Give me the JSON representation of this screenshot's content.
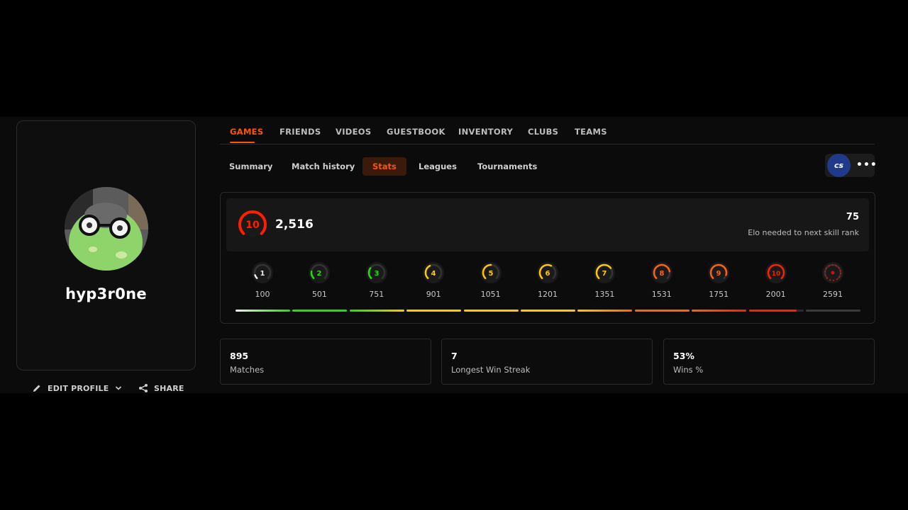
{
  "profile": {
    "username": "hyp3r0ne",
    "edit_label": "EDIT PROFILE",
    "share_label": "SHARE"
  },
  "main_tabs": [
    {
      "label": "GAMES",
      "active": true
    },
    {
      "label": "FRIENDS"
    },
    {
      "label": "VIDEOS"
    },
    {
      "label": "GUESTBOOK"
    },
    {
      "label": "INVENTORY"
    },
    {
      "label": "CLUBS"
    },
    {
      "label": "TEAMS"
    }
  ],
  "sub_tabs": [
    {
      "label": "Summary"
    },
    {
      "label": "Match history"
    },
    {
      "label": "Stats",
      "active": true
    },
    {
      "label": "Leagues"
    },
    {
      "label": "Tournaments"
    }
  ],
  "game_switch": {
    "logo_text": "cs",
    "more_icon": "more-dots-icon"
  },
  "elo": {
    "current_level": "10",
    "value": "2,516",
    "needed": "75",
    "needed_label": "Elo needed to next skill rank"
  },
  "levels": [
    {
      "level": "1",
      "elo": "100",
      "color": "#eeeeee",
      "progress": 0.1
    },
    {
      "level": "2",
      "elo": "501",
      "color": "#1ce400",
      "progress": 0.2
    },
    {
      "level": "3",
      "elo": "751",
      "color": "#1ce400",
      "progress": 0.3
    },
    {
      "level": "4",
      "elo": "901",
      "color": "#ffc800",
      "progress": 0.4
    },
    {
      "level": "5",
      "elo": "1051",
      "color": "#ffc800",
      "progress": 0.5
    },
    {
      "level": "6",
      "elo": "1201",
      "color": "#ffc800",
      "progress": 0.6
    },
    {
      "level": "7",
      "elo": "1351",
      "color": "#ffc800",
      "progress": 0.7
    },
    {
      "level": "8",
      "elo": "1531",
      "color": "#ff6309",
      "progress": 0.8
    },
    {
      "level": "9",
      "elo": "1751",
      "color": "#ff6309",
      "progress": 0.9
    },
    {
      "level": "10",
      "elo": "2001",
      "color": "#fe1f00",
      "progress": 1.0
    },
    {
      "level": "",
      "elo": "2591",
      "color": "#c41414",
      "progress": 0
    }
  ],
  "progress_segments": [
    {
      "color": "#eeeeee",
      "color2": "#1ce400",
      "fill": 1
    },
    {
      "color": "#1ce400",
      "fill": 1
    },
    {
      "color": "#1ce400",
      "color2": "#ffc800",
      "fill": 1
    },
    {
      "color": "#ffc800",
      "fill": 1
    },
    {
      "color": "#ffc800",
      "fill": 1
    },
    {
      "color": "#ffc800",
      "fill": 1
    },
    {
      "color": "#ffc800",
      "color2": "#ff6309",
      "fill": 1
    },
    {
      "color": "#ff6309",
      "fill": 1
    },
    {
      "color": "#ff6309",
      "color2": "#fe1f00",
      "fill": 1
    },
    {
      "color": "#fe1f00",
      "fill": 0.87
    },
    {
      "color": "#3a3a3a",
      "fill": 1
    }
  ],
  "stats": [
    {
      "value": "895",
      "label": "Matches"
    },
    {
      "value": "7",
      "label": "Longest Win Streak"
    },
    {
      "value": "53%",
      "label": "Wins %"
    }
  ]
}
